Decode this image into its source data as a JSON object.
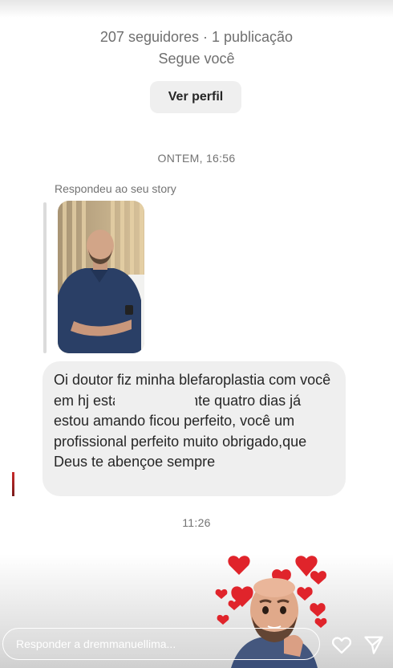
{
  "profile": {
    "stats": "207 seguidores · 1 publicação",
    "follow_status": "Segue você",
    "view_profile_label": "Ver perfil"
  },
  "conversation": {
    "first_timestamp": "ONTEM, 16:56",
    "reply_context": "Respondeu ao seu story",
    "message_text": "Oi doutor fiz minha blefaroplastia com você em                    hj está fazendo vinte quatro dias já estou amando ficou perfeito, você um profissional perfeito muito obrigado,que Deus te abençoe sempre",
    "second_timestamp": "11:26"
  },
  "composer": {
    "placeholder": "Responder a dremmanuellima..."
  },
  "icons": {
    "like": "heart-icon",
    "send": "send-icon"
  },
  "colors": {
    "bubble_background": "#efefef",
    "secondary_text": "#737373",
    "sticker_hearts": "#e0242b"
  }
}
